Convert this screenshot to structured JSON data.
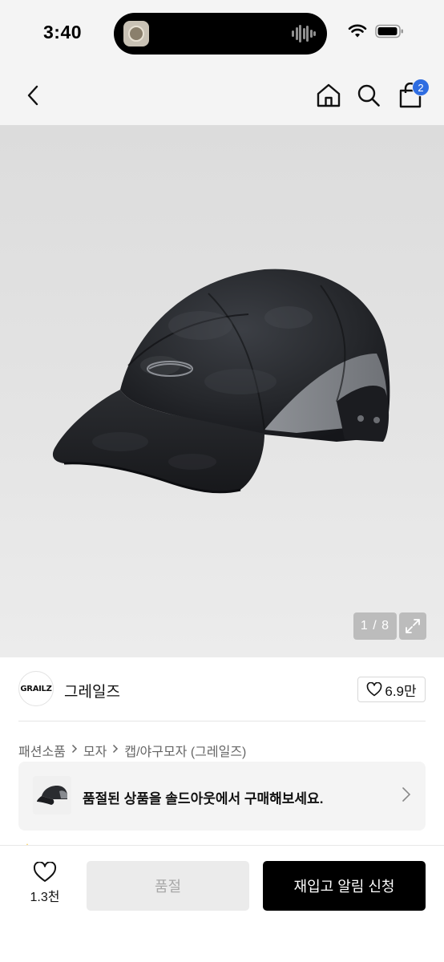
{
  "status_bar": {
    "time": "3:40"
  },
  "nav": {
    "cart_count": "2"
  },
  "product_image": {
    "counter": "1 / 8"
  },
  "brand": {
    "logo_text": "GRAILZ",
    "name": "그레일즈",
    "like_count": "6.9만"
  },
  "breadcrumb": [
    "패션소품",
    "모자",
    "캡/야구모자 (그레일즈)"
  ],
  "soldout_banner": {
    "text": "품절된 상품을 솔드아웃에서 구매해보세요."
  },
  "action_bar": {
    "wish_count": "1.3천",
    "soldout_label": "품절",
    "restock_label": "재입고 알림 신청"
  },
  "colors": {
    "badge": "#2f6de1",
    "primary_button": "#000000",
    "disabled_button": "#ebebeb"
  },
  "icons": [
    "back-chevron-icon",
    "home-icon",
    "search-icon",
    "cart-icon",
    "expand-icon",
    "heart-icon",
    "chevron-right-icon",
    "wifi-icon",
    "battery-icon",
    "waveform-icon"
  ]
}
